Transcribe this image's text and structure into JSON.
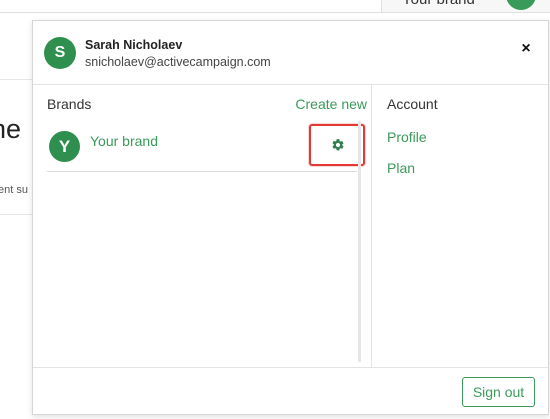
{
  "background": {
    "top_user_name": "Your brand",
    "heading_fragment": "he",
    "subtext_fragment": "ent su"
  },
  "user": {
    "initial": "S",
    "name": "Sarah Nicholaev",
    "email": "snicholaev@activecampaign.com"
  },
  "close_symbol": "×",
  "brands": {
    "title": "Brands",
    "create_new": "Create new",
    "items": [
      {
        "initial": "Y",
        "name": "Your brand",
        "settings_icon": "gear-icon"
      }
    ]
  },
  "account": {
    "title": "Account",
    "links": [
      "Profile",
      "Plan"
    ]
  },
  "footer": {
    "sign_out": "Sign out"
  },
  "colors": {
    "accent": "#3a9a5a",
    "avatar": "#2f8f4f",
    "highlight": "#e53935"
  }
}
